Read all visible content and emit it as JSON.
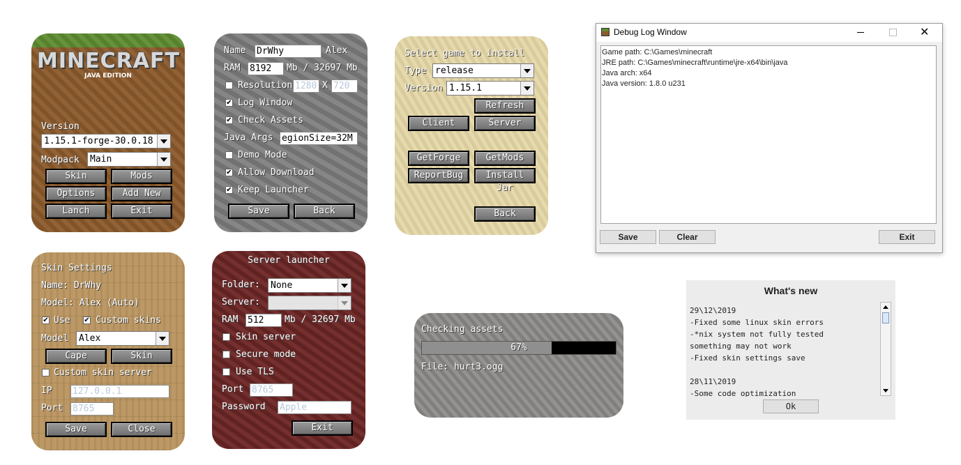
{
  "launcher": {
    "logo_text": "MINECRAFT",
    "logo_sub": "JAVA EDITION",
    "version_label": "Version",
    "version_value": "1.15.1-forge-30.0.18",
    "modpack_label": "Modpack",
    "modpack_value": "Main",
    "buttons": {
      "skin": "Skin",
      "mods": "Mods",
      "options": "Options",
      "add_new": "Add New",
      "launch": "Lanch",
      "exit": "Exit"
    }
  },
  "options": {
    "name_label": "Name",
    "name_value": "DrWhy",
    "name_suffix": "Alex",
    "ram_label": "RAM",
    "ram_value": "8192",
    "ram_suffix": "Mb / 32697 Mb",
    "resolution_label": "Resolution",
    "res_w": "1280",
    "res_x": "X",
    "res_h": "720",
    "log_window": "Log Window",
    "check_assets": "Check Assets",
    "java_args_label": "Java Args",
    "java_args_value": "egionSize=32M",
    "demo_mode": "Demo Mode",
    "allow_download": "Allow Download",
    "keep_launcher": "Keep Launcher",
    "check_mark": "✔",
    "save": "Save",
    "back": "Back"
  },
  "install": {
    "title": "Select game to install",
    "type_label": "Type",
    "type_value": "release",
    "version_label": "Version",
    "version_value": "1.15.1",
    "refresh": "Refresh",
    "client": "Client",
    "server": "Server",
    "get_forge": "GetForge",
    "get_mods": "GetMods",
    "report_bug": "ReportBug",
    "install_jar": "Install Jar",
    "back": "Back"
  },
  "debug": {
    "title": "Debug Log Window",
    "lines": [
      "Game path: C:\\Games\\minecraft",
      "JRE path: C:\\Games\\minecraft\\runtime\\jre-x64\\bin\\java",
      "Java arch: x64",
      "Java version: 1.8.0 u231"
    ],
    "save": "Save",
    "clear": "Clear",
    "exit": "Exit"
  },
  "skin": {
    "title": "Skin Settings",
    "name_line": "Name: DrWhy",
    "model_line": "Model: Alex (Auto)",
    "use": "Use",
    "custom_skins": "Custom skins",
    "model_label": "Model",
    "model_value": "Alex",
    "cape": "Cape",
    "skin": "Skin",
    "custom_server": "Custom skin server",
    "ip_label": "IP",
    "ip_value": "127.0.0.1",
    "port_label": "Port",
    "port_value": "8765",
    "save": "Save",
    "close": "Close"
  },
  "server": {
    "title": "Server launcher",
    "folder_label": "Folder:",
    "folder_value": "None",
    "server_label": "Server:",
    "ram_label": "RAM",
    "ram_value": "512",
    "ram_suffix": "Mb / 32697 Mb",
    "skin_server": "Skin server",
    "secure_mode": "Secure mode",
    "use_tls": "Use TLS",
    "port_label": "Port",
    "port_value": "8765",
    "password_label": "Password",
    "password_value": "Apple",
    "exit": "Exit"
  },
  "assets": {
    "title": "Checking assets",
    "progress_text": "67%",
    "progress": 0.67,
    "file_line": "File: hurt3.ogg"
  },
  "whats_new": {
    "title": "What's new",
    "lines": [
      "29\\12\\2019",
      "-Fixed some linux skin errors",
      "-*nix system not fully tested",
      "something may not work",
      "-Fixed skin settings save",
      "",
      "28\\11\\2019",
      "-Some code optimization"
    ],
    "ok": "Ok"
  },
  "colors": {
    "grass": "#5e8c31",
    "dirt": "#8b5a2b",
    "stone": "#7f7f7f",
    "sand": "#e4d6a5",
    "planks": "#b8945f",
    "netherrack": "#6e2727",
    "gravel": "#8c8a88"
  }
}
